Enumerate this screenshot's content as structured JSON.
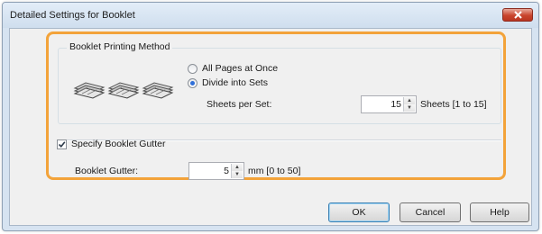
{
  "window": {
    "title": "Detailed Settings for Booklet"
  },
  "booklet_method": {
    "legend": "Booklet Printing Method",
    "options": [
      {
        "label": "All Pages at Once",
        "selected": false
      },
      {
        "label": "Divide into Sets",
        "selected": true
      }
    ],
    "sheets_per_set": {
      "label": "Sheets per Set:",
      "value": "15",
      "range": "Sheets [1 to 15]"
    }
  },
  "gutter": {
    "checkbox_label": "Specify Booklet Gutter",
    "checked": true,
    "label": "Booklet Gutter:",
    "value": "5",
    "unit": "mm [0 to 50]"
  },
  "buttons": {
    "ok": "OK",
    "cancel": "Cancel",
    "help": "Help"
  },
  "colors": {
    "highlight": "#f3a33a",
    "close_button": "#c9452e",
    "radio_selected": "#2f6fd8"
  },
  "icons": [
    "booklet-icon",
    "close-icon",
    "checkmark-icon",
    "spin-up-icon",
    "spin-down-icon"
  ]
}
